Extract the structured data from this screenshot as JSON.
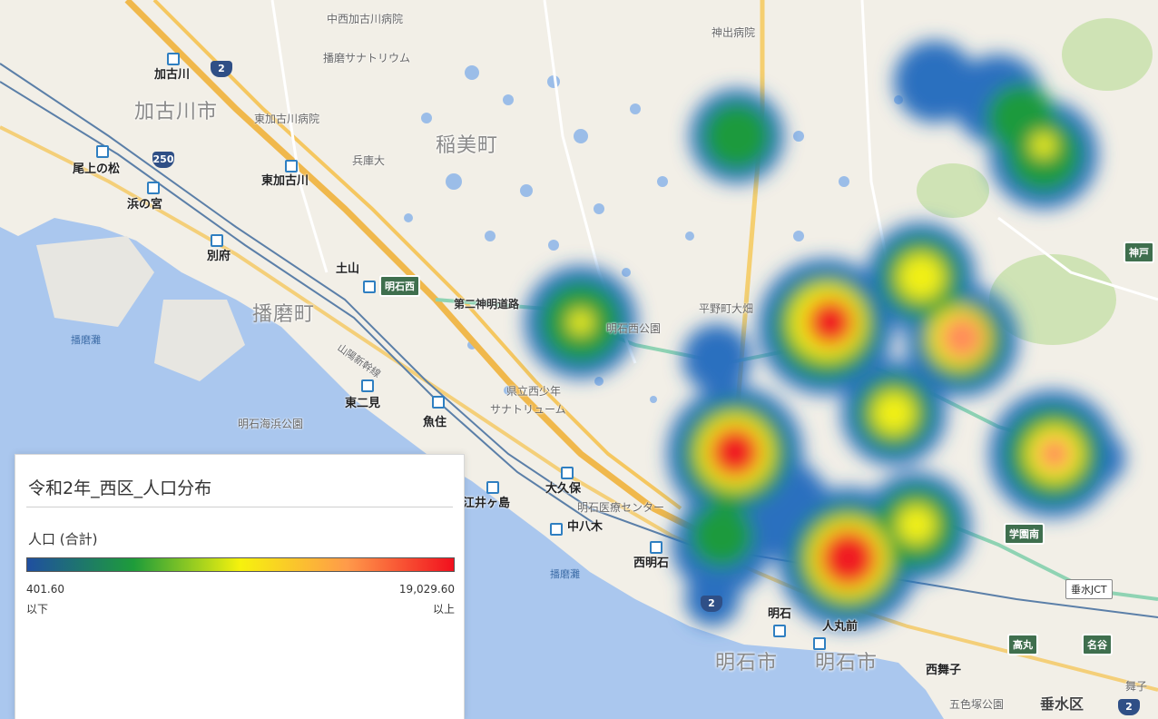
{
  "legend": {
    "title": "令和2年_西区_人口分布",
    "measure": "人口 (合計)",
    "min_value": "401.60",
    "min_suffix": "以下",
    "max_value": "19,029.60",
    "max_suffix": "以上",
    "gradient_colors": [
      "#1f4fa0",
      "#1e9c3a",
      "#f6f20d",
      "#ff9a4a",
      "#f1101e"
    ]
  },
  "map": {
    "cities": [
      "加古川市",
      "稲美町",
      "播磨町",
      "明石市",
      "明石市",
      "垂水区"
    ],
    "places": [
      "加古川",
      "尾上の松",
      "浜の宮",
      "別府",
      "土山",
      "東加古川",
      "東二見",
      "魚住",
      "大久保",
      "中八木",
      "西明石",
      "明石",
      "人丸前",
      "西舞子",
      "江井ヶ島"
    ],
    "pois": [
      "中西加古川病院",
      "播磨サナトリウム",
      "東加古川病院",
      "兵庫大",
      "神出病院",
      "平野町大畑",
      "明石西公園",
      "県立西少年",
      "サナトリューム",
      "明石医療センター",
      "明石海浜公園",
      "五色塚公園",
      "舞子"
    ],
    "seas": [
      "播磨灘",
      "播磨灘"
    ],
    "routes": [
      "2",
      "250",
      "2",
      "2"
    ],
    "interchanges": [
      "明石西",
      "学園南",
      "高丸",
      "名谷",
      "神戸"
    ],
    "junctions": [
      "垂水JCT",
      "第二神明道路",
      "山陽新幹線"
    ]
  },
  "heatmap": {
    "levels": [
      "high",
      "high",
      "high",
      "medium-high",
      "medium",
      "medium",
      "medium",
      "medium",
      "low",
      "low",
      "low",
      "low",
      "low"
    ]
  }
}
